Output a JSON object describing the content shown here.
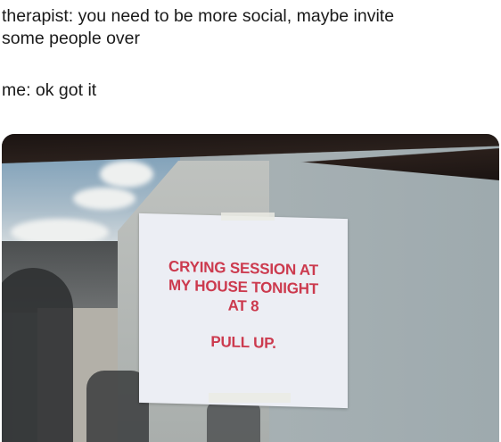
{
  "caption": {
    "line1": "therapist: you need to be more social, maybe invite",
    "line2": "some people over",
    "reply": "me: ok got it"
  },
  "sign": {
    "lines": [
      "CRYING SESSION AT",
      "MY HOUSE TONIGHT",
      "AT 8"
    ],
    "footer": "PULL UP."
  },
  "colors": {
    "sign_text": "#cc3a4e",
    "caption_text": "#1a1a1a"
  }
}
